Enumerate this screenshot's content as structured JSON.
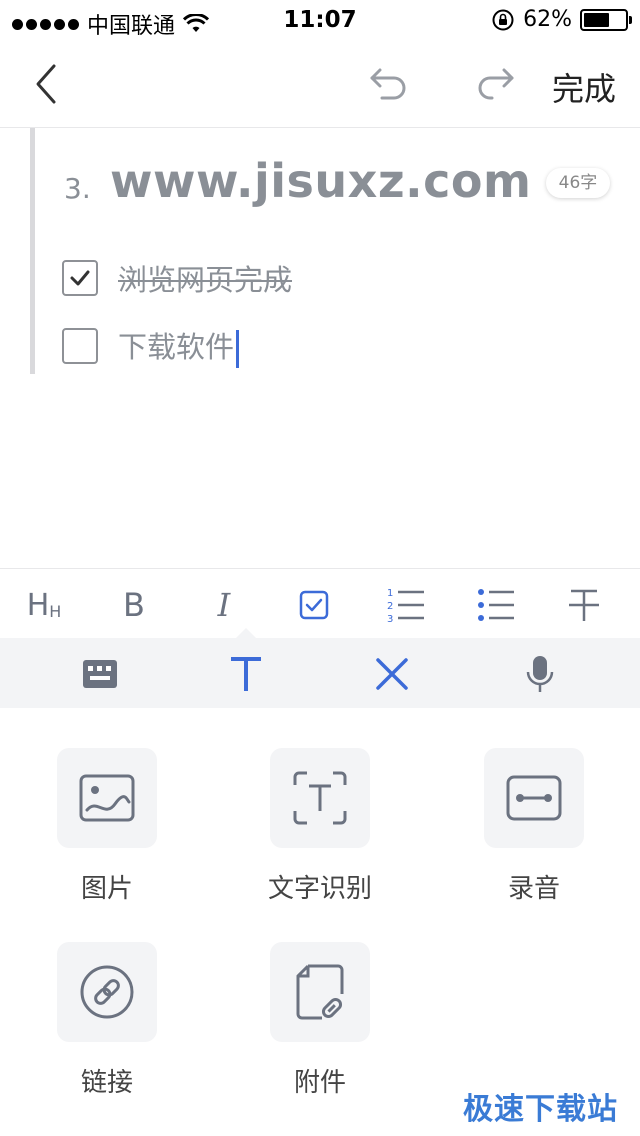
{
  "status_bar": {
    "carrier": "中国联通",
    "time": "11:07",
    "battery_text": "62%",
    "battery_level": 0.62
  },
  "nav": {
    "done_label": "完成"
  },
  "note": {
    "heading_number": "3.",
    "heading_text": "www.jisuxz.com",
    "word_count": "46字",
    "tasks": [
      {
        "label": "浏览网页完成",
        "checked": true
      },
      {
        "label": "下载软件",
        "checked": false
      }
    ]
  },
  "format_toolbar": {
    "heading_label": "H",
    "heading_sub": "H",
    "bold_label": "B",
    "italic_label": "I",
    "icons": [
      "heading-icon",
      "bold-icon",
      "italic-icon",
      "checkbox-icon",
      "numbered-list-icon",
      "bullet-list-icon",
      "strikethrough-icon"
    ]
  },
  "mode_bar": {
    "icons": [
      "keyboard-icon",
      "text-format-icon",
      "close-icon",
      "microphone-icon"
    ],
    "active": "text-format-icon"
  },
  "insert_panel": {
    "items": [
      {
        "label": "图片",
        "icon": "image-icon"
      },
      {
        "label": "文字识别",
        "icon": "text-recognition-icon"
      },
      {
        "label": "录音",
        "icon": "recording-icon"
      },
      {
        "label": "链接",
        "icon": "link-icon"
      },
      {
        "label": "附件",
        "icon": "attachment-icon"
      }
    ]
  },
  "watermark": "极速下载站",
  "colors": {
    "accent": "#3c6bd8",
    "icon_gray": "#6b7280",
    "panel_bg": "#f3f4f6",
    "text_gray": "#8a8f96"
  }
}
